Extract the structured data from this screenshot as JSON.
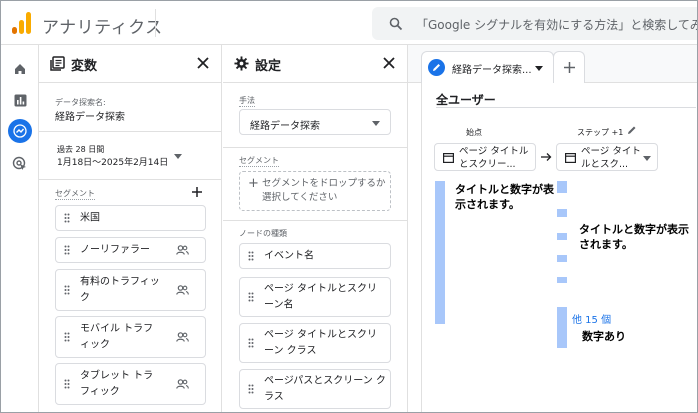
{
  "app": {
    "title": "アナリティクス"
  },
  "search": {
    "text": "「Google シグナルを有効にする方法」と検索してみてく"
  },
  "rail": {
    "icons": [
      "home-icon",
      "reports-icon",
      "explore-icon",
      "advertising-icon"
    ],
    "active_color": "#1a73e8"
  },
  "variables": {
    "title": "変数",
    "exploration_name_label": "データ探索名:",
    "exploration_name": "経路データ探索",
    "date_label": "過去 28 日間",
    "date_range": "1月18日～2025年2月14日",
    "segments_label": "セグメント",
    "segments": [
      "米国",
      "ノーリファラー",
      "有料のトラフィック",
      "モバイル トラフィック",
      "タブレット トラフィック"
    ]
  },
  "settings": {
    "title": "設定",
    "technique_label": "手法",
    "technique_value": "経路データ探索",
    "segment_label": "セグメント",
    "segment_drop": "セグメントをドロップするか選択してください",
    "node_type_label": "ノードの種類",
    "node_types": [
      "イベント名",
      "ページ タイトルとスクリーン名",
      "ページ タイトルとスクリーン クラス",
      "ページパスとスクリーン クラス"
    ]
  },
  "exploration": {
    "tab_label": "経路データ探索...",
    "segment_name": "全ユーザー",
    "start_label": "始点",
    "step_label": "ステップ +1",
    "start_node": "ページ タイトルとスクリー...",
    "step_node": "ページ タイトルとスク...",
    "callout1": "タイトルと数字が表示されます。",
    "callout2": "タイトルと数字が表示されます。",
    "more_label": "他 15 個",
    "callout3": "数字あり",
    "bar_color": "#a8c7fa",
    "link_color": "#1a73e8"
  }
}
